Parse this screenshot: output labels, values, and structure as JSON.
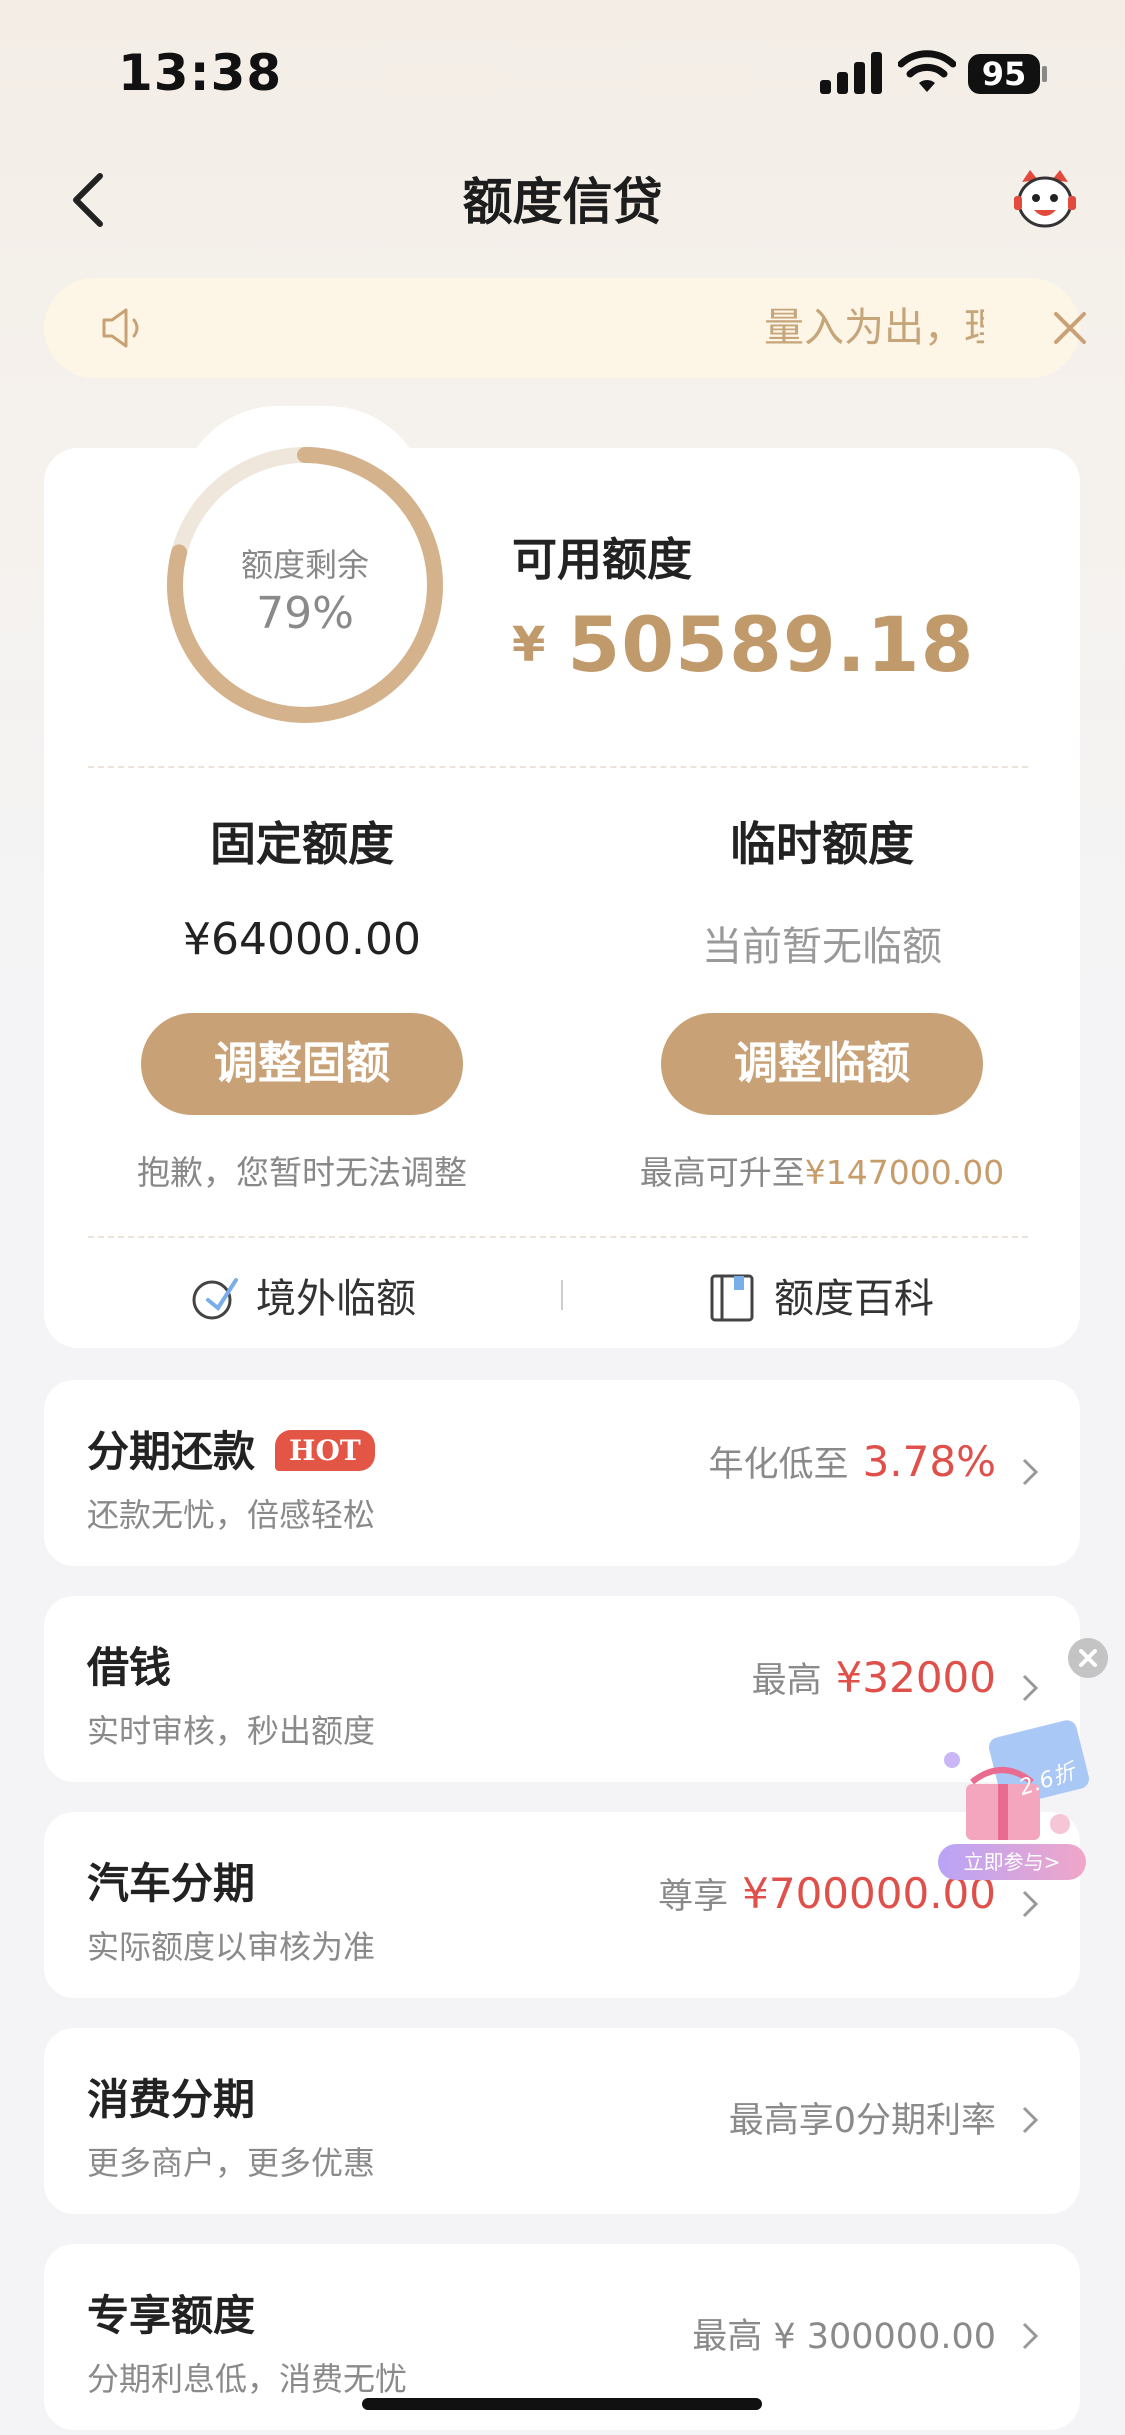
{
  "status": {
    "time": "13:38",
    "battery": "95"
  },
  "header": {
    "title": "额度信贷"
  },
  "notice": {
    "text": "量入为出，理性消费"
  },
  "credit": {
    "ring_label": "额度剩余",
    "ring_percent": "79%",
    "ring_fraction": 0.79,
    "available_label": "可用额度",
    "currency": "¥",
    "available_value": "50589.18",
    "fixed": {
      "title": "固定额度",
      "value": "¥64000.00",
      "button": "调整固额",
      "note": "抱歉，您暂时无法调整"
    },
    "temporary": {
      "title": "临时额度",
      "value": "当前暂无临额",
      "button": "调整临额",
      "note_prefix": "最高可升至",
      "note_value": "¥147000.00"
    },
    "links": {
      "overseas": "境外临额",
      "wiki": "额度百科"
    }
  },
  "rows": [
    {
      "title": "分期还款",
      "badge": "HOT",
      "subtitle": "还款无忧，倍感轻松",
      "prefix": "年化低至",
      "value": "3.78%"
    },
    {
      "title": "借钱",
      "subtitle": "实时审核，秒出额度",
      "prefix": "最高",
      "value": "¥32000"
    },
    {
      "title": "汽车分期",
      "subtitle": "实际额度以审核为准",
      "prefix": "尊享",
      "value": "¥700000.00"
    },
    {
      "title": "消费分期",
      "subtitle": "更多商户，更多优惠",
      "text": "最高享0分期利率"
    },
    {
      "title": "专享额度",
      "subtitle": "分期利息低，消费无忧",
      "text": "最高 ¥ 300000.00"
    }
  ],
  "promo": {
    "tag": "2.6折",
    "button": "立即参与>"
  },
  "colors": {
    "gold": "#c9a176",
    "red": "#e0504a"
  }
}
